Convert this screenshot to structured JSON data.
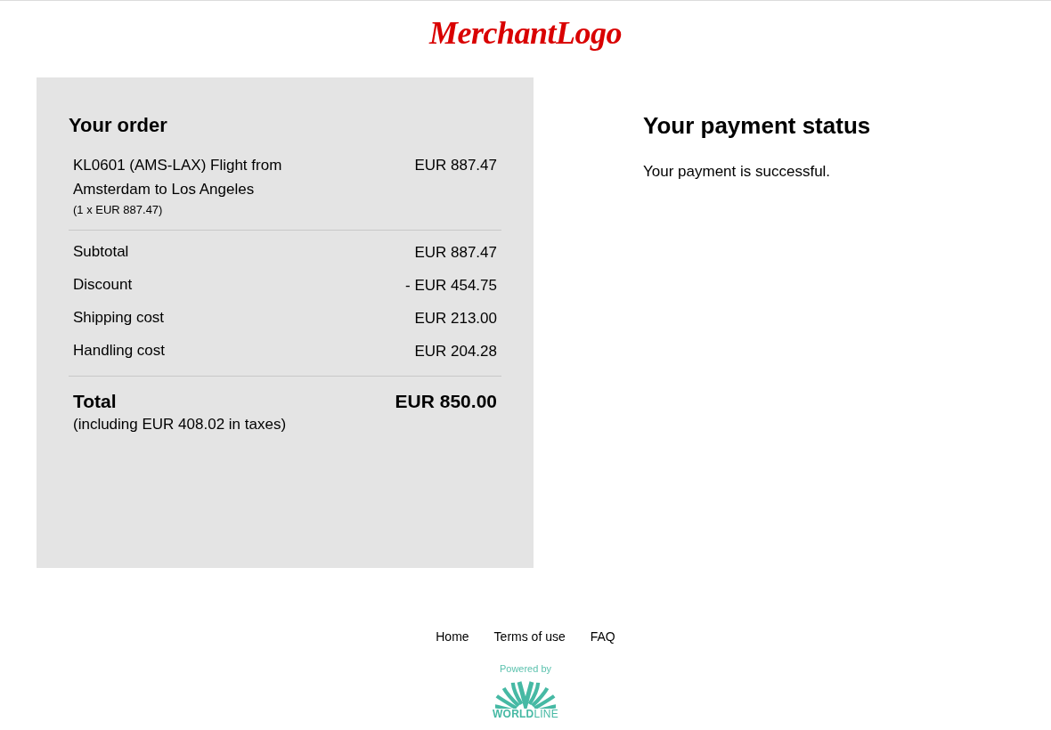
{
  "header": {
    "logo_text": "MerchantLogo"
  },
  "order": {
    "title": "Your order",
    "items": [
      {
        "name": "KL0601 (AMS-LAX) Flight from Amsterdam to Los Angeles",
        "price": "EUR 887.47",
        "quantity_note": "(1 x EUR 887.47)"
      }
    ],
    "summary": [
      {
        "label": "Subtotal",
        "value": "EUR 887.47"
      },
      {
        "label": "Discount",
        "value": "- EUR 454.75"
      },
      {
        "label": "Shipping cost",
        "value": "EUR 213.00"
      },
      {
        "label": "Handling cost",
        "value": "EUR 204.28"
      }
    ],
    "total": {
      "label": "Total",
      "value": "EUR 850.00",
      "note": "(including EUR 408.02 in taxes)"
    }
  },
  "payment_status": {
    "title": "Your payment status",
    "message": "Your payment is successful."
  },
  "footer": {
    "links": [
      "Home",
      "Terms of use",
      "FAQ"
    ],
    "powered_by": "Powered by",
    "brand": "**WORLD**LINE"
  }
}
